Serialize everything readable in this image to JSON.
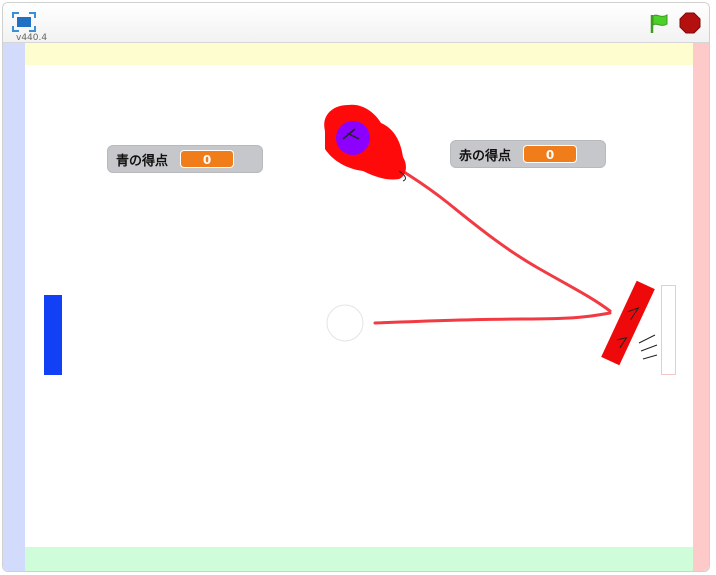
{
  "player": {
    "version": "v440.4"
  },
  "controls": {
    "fullscreen_icon": "fullscreen-icon",
    "green_flag_icon": "green-flag-icon",
    "stop_icon": "stop-sign-icon"
  },
  "monitors": {
    "blue_score": {
      "label": "青の得点",
      "value": "0"
    },
    "red_score": {
      "label": "赤の得点",
      "value": "0"
    }
  },
  "colors": {
    "blue_paddle": "#1140f5",
    "red_paddle": "#ee0a0a",
    "monitor_value_bg": "#f07d1a",
    "left_wall": "#d3dbfd",
    "right_wall": "#fdc9c9",
    "top_wall": "#fefdd0",
    "bottom_wall": "#d0fdd9",
    "trail": "#f23a43",
    "fireball": "#ff0a0a",
    "fireball_core": "#8b00ff"
  }
}
